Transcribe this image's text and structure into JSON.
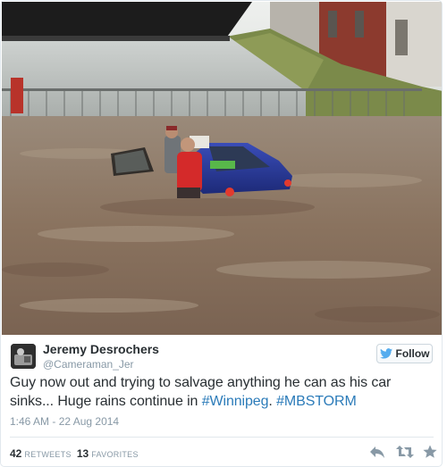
{
  "tweet": {
    "author_name": "Jeremy Desrochers",
    "author_handle": "@Cameraman_Jer",
    "follow_label": "Follow",
    "text_before": "Guy now out and trying to salvage anything he can as his car sinks... Huge rains continue in ",
    "hashtag_1": "#Winnipeg",
    "text_between": ". ",
    "hashtag_2": "#MBSTORM",
    "timestamp": "1:46 AM - 22 Aug 2014",
    "retweets_count": "42",
    "retweets_label": "RETWEETS",
    "favorites_count": "13",
    "favorites_label": "FAVORITES"
  },
  "icons": {
    "follow": "twitter-bird-icon",
    "reply": "reply-icon",
    "retweet": "retweet-icon",
    "favorite": "star-icon"
  },
  "colors": {
    "hashtag": "#2b7bb9",
    "secondary_text": "#8899a6",
    "primary_text": "#292f33",
    "bird": "#55acee"
  }
}
